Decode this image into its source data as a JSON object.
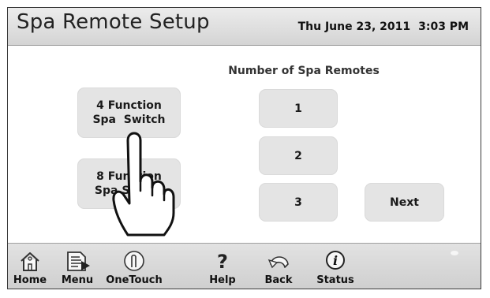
{
  "header": {
    "title": "Spa Remote Setup",
    "date": "Thu June 23, 2011",
    "time": "3:03 PM"
  },
  "options": {
    "four_function": {
      "line1": "4 Function",
      "line2": "Spa  Switch"
    },
    "eight_function": {
      "line1": "8 Function",
      "line2": "Spa Switch"
    }
  },
  "remotes": {
    "heading": "Number of Spa Remotes",
    "counts": [
      "1",
      "2",
      "3"
    ],
    "next_label": "Next"
  },
  "footer": {
    "items": [
      {
        "label": "Home",
        "icon": "home-icon"
      },
      {
        "label": "Menu",
        "icon": "menu-icon"
      },
      {
        "label": "OneTouch",
        "icon": "onetouch-icon"
      },
      {
        "label": "Help",
        "icon": "help-icon"
      },
      {
        "label": "Back",
        "icon": "back-icon"
      },
      {
        "label": "Status",
        "icon": "status-icon"
      }
    ]
  }
}
